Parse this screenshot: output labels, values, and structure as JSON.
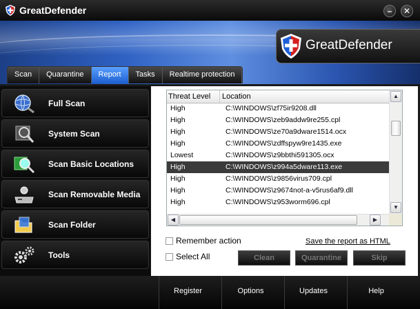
{
  "window": {
    "title": "GreatDefender",
    "minimize_label": "–",
    "close_label": "✕"
  },
  "banner": {
    "brand": "GreatDefender"
  },
  "tabs": [
    {
      "label": "Scan"
    },
    {
      "label": "Quarantine"
    },
    {
      "label": "Report"
    },
    {
      "label": "Tasks"
    },
    {
      "label": "Realtime protection"
    }
  ],
  "active_tab": "Report",
  "sidebar": {
    "items": [
      {
        "label": "Full Scan",
        "icon": "globe-magnifier-icon"
      },
      {
        "label": "System Scan",
        "icon": "system-magnifier-icon"
      },
      {
        "label": "Scan Basic Locations",
        "icon": "location-magnifier-icon"
      },
      {
        "label": "Scan Removable Media",
        "icon": "removable-drive-icon"
      },
      {
        "label": "Scan Folder",
        "icon": "folder-icon"
      },
      {
        "label": "Tools",
        "icon": "gears-icon"
      }
    ]
  },
  "report": {
    "columns": [
      "Threat Level",
      "Location"
    ],
    "rows": [
      {
        "level": "High",
        "location": "C:\\WINDOWS\\zf75ir9208.dll"
      },
      {
        "level": "High",
        "location": "C:\\WINDOWS\\zeb9addw9re255.cpl"
      },
      {
        "level": "High",
        "location": "C:\\WINDOWS\\ze70a9dware1514.ocx"
      },
      {
        "level": "High",
        "location": "C:\\WINDOWS\\zdffspyw9re1435.exe"
      },
      {
        "level": "Lowest",
        "location": "C:\\WINDOWS\\z9bbthi591305.ocx"
      },
      {
        "level": "High",
        "location": "C:\\WINDOWS\\z994a5dware113.exe"
      },
      {
        "level": "High",
        "location": "C:\\WINDOWS\\z9856virus709.cpl"
      },
      {
        "level": "High",
        "location": "C:\\WINDOWS\\z9674not-a-v5rus6af9.dll"
      },
      {
        "level": "High",
        "location": "C:\\WINDOWS\\z953worm696.cpl"
      }
    ],
    "selected_row_index": 5
  },
  "options": {
    "remember_action_label": "Remember action",
    "select_all_label": "Select All",
    "save_report_link": "Save the report as HTML"
  },
  "actions": {
    "clean_label": "Clean",
    "quarantine_label": "Quarantine",
    "skip_label": "Skip"
  },
  "footer": {
    "register_label": "Register",
    "options_label": "Options",
    "updates_label": "Updates",
    "help_label": "Help"
  },
  "colors": {
    "active_tab": "#2f7be8",
    "selected_row": "#3b3b3b",
    "banner": "#2f62c4"
  }
}
